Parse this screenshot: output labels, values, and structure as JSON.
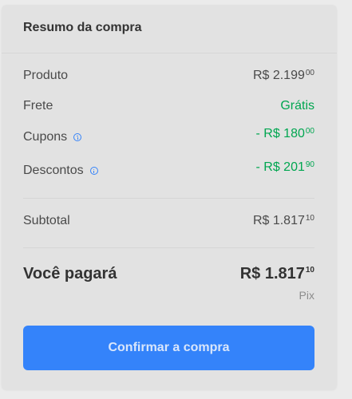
{
  "summary": {
    "title": "Resumo da compra",
    "rows": {
      "produto": {
        "label": "Produto",
        "amount": "R$ 2.199",
        "cents": "00"
      },
      "frete": {
        "label": "Frete",
        "amount": "Grátis"
      },
      "cupons": {
        "label": "Cupons",
        "amount": "- R$ 180",
        "cents": "00"
      },
      "descontos": {
        "label": "Descontos",
        "amount": "- R$ 201",
        "cents": "90"
      },
      "subtotal": {
        "label": "Subtotal",
        "amount": "R$ 1.817",
        "cents": "10"
      }
    },
    "total": {
      "label": "Você pagará",
      "amount": "R$ 1.817",
      "cents": "10",
      "method": "Pix"
    },
    "confirm_label": "Confirmar a compra"
  },
  "colors": {
    "accent": "#3483fa",
    "positive": "#00a650",
    "text": "#333333",
    "muted": "#8c8c8c"
  },
  "icons": {
    "info": "info-icon"
  }
}
